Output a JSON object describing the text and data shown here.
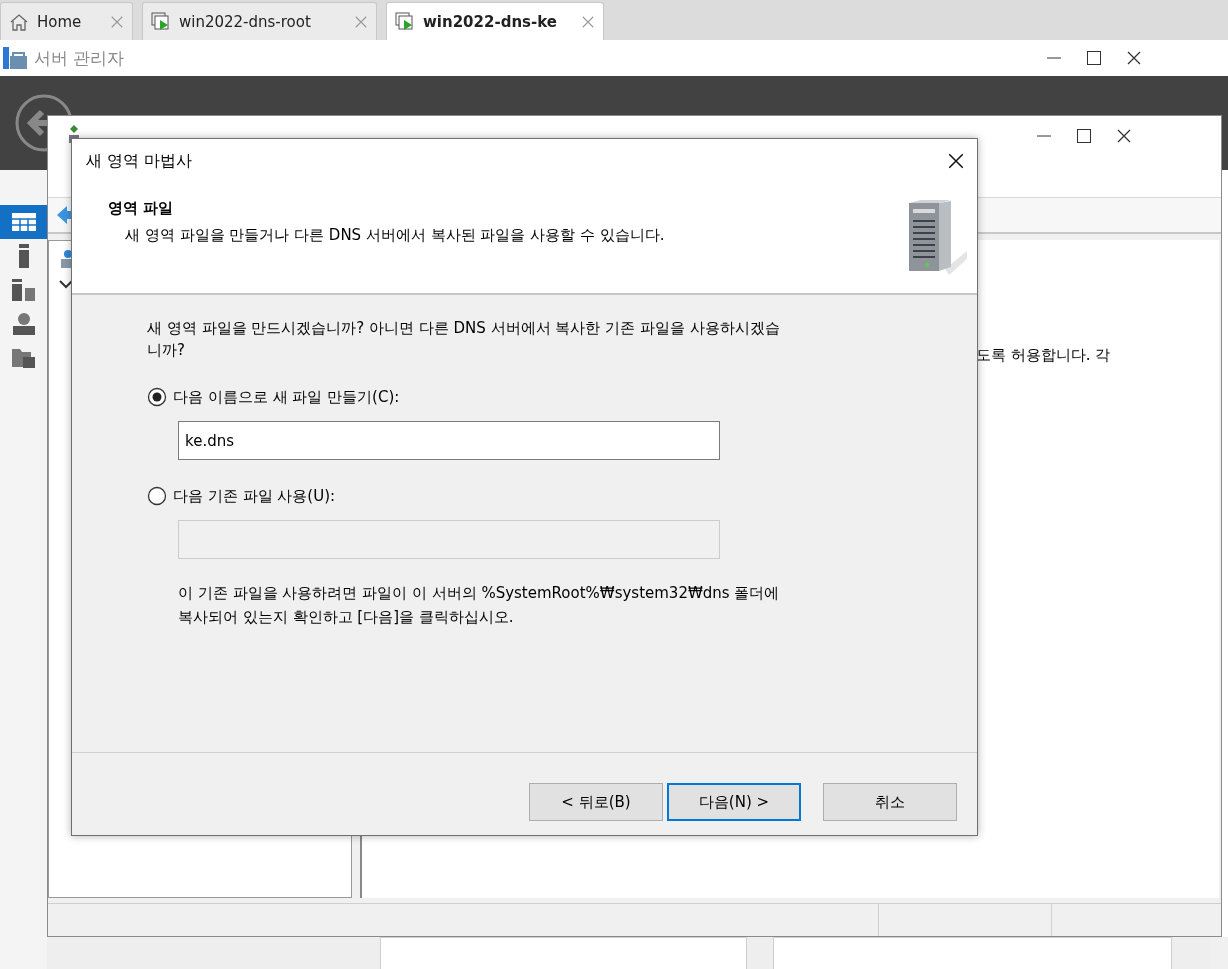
{
  "browser_tabs": [
    {
      "label": "Home",
      "kind": "home",
      "selected": false
    },
    {
      "label": "win2022-dns-root",
      "kind": "vm",
      "selected": false
    },
    {
      "label": "win2022-dns-ke",
      "kind": "vm",
      "selected": true
    }
  ],
  "server_manager": {
    "title": "서버 관리자",
    "sidebar": {
      "items": [
        {
          "kind": "dashboard",
          "selected": true
        },
        {
          "kind": "local",
          "selected": false
        },
        {
          "kind": "all",
          "selected": false
        },
        {
          "kind": "dns",
          "selected": false
        },
        {
          "kind": "files",
          "selected": false
        }
      ]
    }
  },
  "dns_manager": {
    "right_pane_text": "도록 허용합니다. 각"
  },
  "wizard": {
    "title": "새 영역 마법사",
    "heading": "영역 파일",
    "subheading": "새 영역 파일을 만들거나 다른 DNS 서버에서 복사된 파일을 사용할 수 있습니다.",
    "question": "새 영역 파일을 만드시겠습니까? 아니면 다른 DNS 서버에서 복사한 기존 파일을 사용하시겠습니까?",
    "options": [
      {
        "label": "다음 이름으로 새 파일 만들기(C):",
        "selected": true,
        "value": "ke.dns"
      },
      {
        "label": "다음 기존 파일 사용(U):",
        "selected": false
      }
    ],
    "note": "이 기존 파일을 사용하려면 파일이 이 서버의 %SystemRoot%₩system32₩dns 폴더에 복사되어 있는지 확인하고 [다음]을 클릭하십시오.",
    "buttons": [
      {
        "label": "< 뒤로(B)",
        "default": false
      },
      {
        "label": "다음(N) >",
        "default": true
      },
      {
        "label": "취소",
        "default": false
      }
    ]
  }
}
